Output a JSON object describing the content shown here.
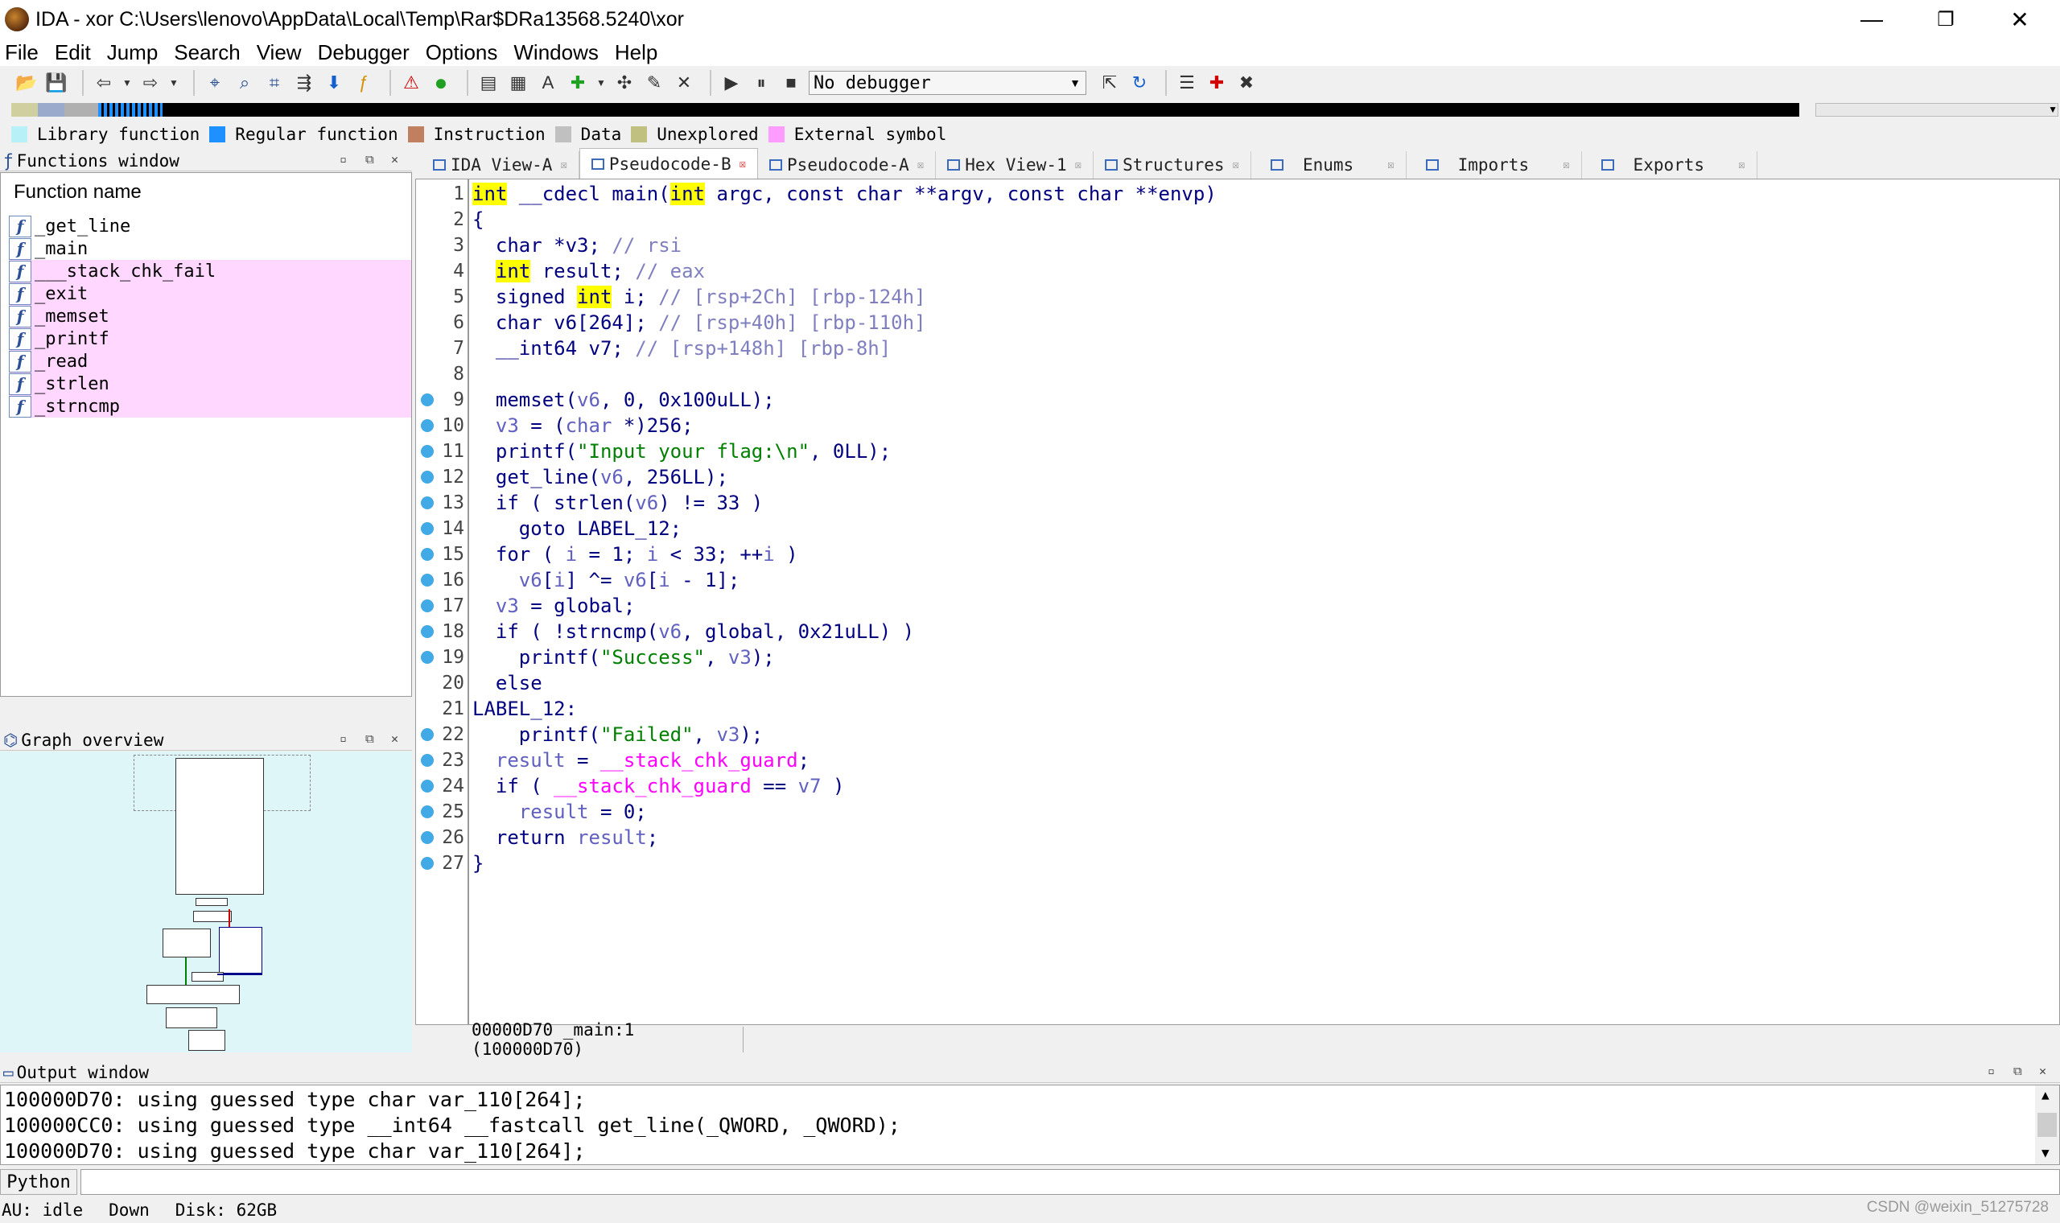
{
  "window": {
    "title": "IDA - xor C:\\Users\\lenovo\\AppData\\Local\\Temp\\Rar$DRa13568.5240\\xor",
    "minimize": "—",
    "restore": "❐",
    "close": "✕"
  },
  "menu": [
    "File",
    "Edit",
    "Jump",
    "Search",
    "View",
    "Debugger",
    "Options",
    "Windows",
    "Help"
  ],
  "toolbar": {
    "debugger_select": "No debugger"
  },
  "legend": [
    {
      "label": "Library function",
      "color": "#b8f0f8"
    },
    {
      "label": "Regular function",
      "color": "#1e90ff"
    },
    {
      "label": "Instruction",
      "color": "#c08060"
    },
    {
      "label": "Data",
      "color": "#c0c0c0"
    },
    {
      "label": "Unexplored",
      "color": "#c0c080"
    },
    {
      "label": "External symbol",
      "color": "#ff9cff"
    }
  ],
  "functions_window": {
    "title": "Functions window",
    "header": "Function name",
    "items": [
      "_get_line",
      "_main",
      "___stack_chk_fail",
      "_exit",
      "_memset",
      "_printf",
      "_read",
      "_strlen",
      "_strncmp"
    ],
    "external_start": 2
  },
  "graph_overview": {
    "title": "Graph overview"
  },
  "tabs": [
    "IDA View-A",
    "Pseudocode-B",
    "Pseudocode-A",
    "Hex View-1",
    "Structures",
    "Enums",
    "Imports",
    "Exports"
  ],
  "active_tab": 1,
  "code": {
    "breakpoint_lines": [
      9,
      10,
      11,
      12,
      13,
      14,
      15,
      16,
      17,
      18,
      19,
      22,
      23,
      24,
      25,
      26,
      27
    ],
    "lines": [
      "1",
      "2",
      "3",
      "4",
      "5",
      "6",
      "7",
      "8",
      "9",
      "10",
      "11",
      "12",
      "13",
      "14",
      "15",
      "16",
      "17",
      "18",
      "19",
      "20",
      "21",
      "22",
      "23",
      "24",
      "25",
      "26",
      "27"
    ]
  },
  "code_status": "00000D70 _main:1 (100000D70)",
  "output_window": {
    "title": "Output window",
    "lines": [
      "100000D70: using guessed type char var_110[264];",
      "100000CC0: using guessed type __int64 __fastcall get_line(_QWORD, _QWORD);",
      "100000D70: using guessed type char var_110[264];"
    ]
  },
  "python_button": "Python",
  "status": {
    "au": "AU:  idle",
    "dir": "Down",
    "disk": "Disk: 62GB"
  },
  "watermark": "CSDN @weixin_51275728"
}
